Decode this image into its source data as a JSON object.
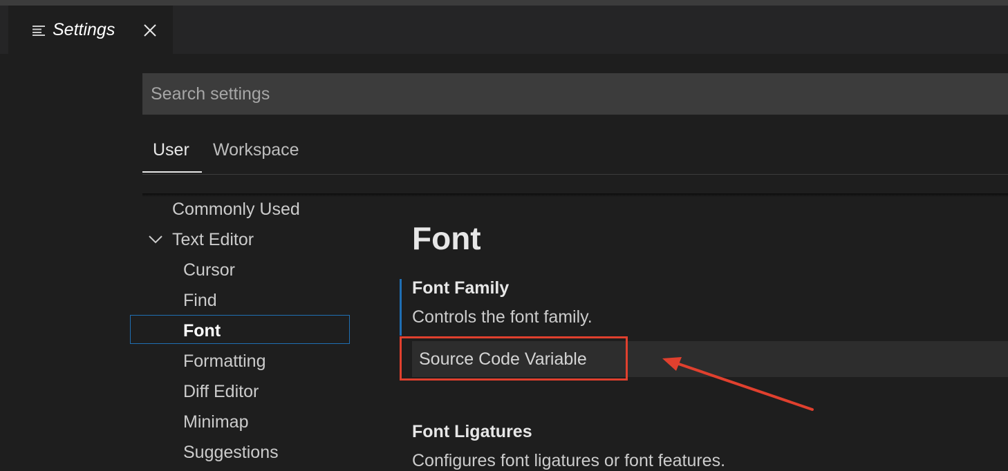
{
  "tab": {
    "title": "Settings",
    "menu_icon": "list-icon",
    "close_icon": "close-icon"
  },
  "search": {
    "placeholder": "Search settings"
  },
  "scope_tabs": {
    "user": "User",
    "workspace": "Workspace",
    "active": "User"
  },
  "toc": {
    "items": [
      {
        "label": "Commonly Used"
      },
      {
        "label": "Text Editor",
        "expanded": true
      },
      {
        "label": "Cursor"
      },
      {
        "label": "Find"
      },
      {
        "label": "Font",
        "selected": true
      },
      {
        "label": "Formatting"
      },
      {
        "label": "Diff Editor"
      },
      {
        "label": "Minimap"
      },
      {
        "label": "Suggestions"
      }
    ]
  },
  "content": {
    "section_title": "Font",
    "settings": [
      {
        "title": "Font Family",
        "description": "Controls the font family.",
        "value": "Source Code Variable"
      },
      {
        "title": "Font Ligatures",
        "description": "Configures font ligatures or font features."
      }
    ]
  },
  "annotation": {
    "color": "#e0402e"
  },
  "colors": {
    "background": "#1e1e1e",
    "accent": "#1f6fb4"
  }
}
